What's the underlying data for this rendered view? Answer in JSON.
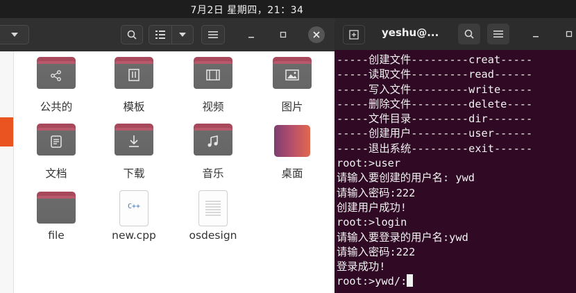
{
  "top_bar": {
    "clock": "7月2日 星期四，21：34"
  },
  "file_manager": {
    "items": [
      {
        "label": "公共的",
        "icon": "share-icon"
      },
      {
        "label": "模板",
        "icon": "template-icon"
      },
      {
        "label": "视频",
        "icon": "video-icon"
      },
      {
        "label": "图片",
        "icon": "image-icon"
      },
      {
        "label": "文档",
        "icon": "document-icon"
      },
      {
        "label": "下载",
        "icon": "download-icon"
      },
      {
        "label": "音乐",
        "icon": "music-icon"
      },
      {
        "label": "桌面",
        "icon": "desktop-folder-icon"
      },
      {
        "label": "file",
        "icon": "folder-icon"
      },
      {
        "label": "new.cpp",
        "icon": "cpp-file-icon",
        "badge": "C++"
      },
      {
        "label": "osdesign",
        "icon": "text-file-icon"
      }
    ]
  },
  "terminal": {
    "title": "yeshu@...",
    "lines": [
      "-----创建文件---------creat-----",
      "-----读取文件---------read------",
      "-----写入文件---------write-----",
      "-----删除文件---------delete----",
      "-----文件目录---------dir-------",
      "-----创建用户---------user------",
      "-----退出系统---------exit------",
      "root:>user",
      "请输入要创建的用户名: ywd",
      "请输入密码:222",
      "创建用户成功!",
      "root:>login",
      "请输入要登录的用户名:ywd",
      "请输入密码:222",
      "登录成功!"
    ],
    "prompt": "root:>ywd/:"
  }
}
